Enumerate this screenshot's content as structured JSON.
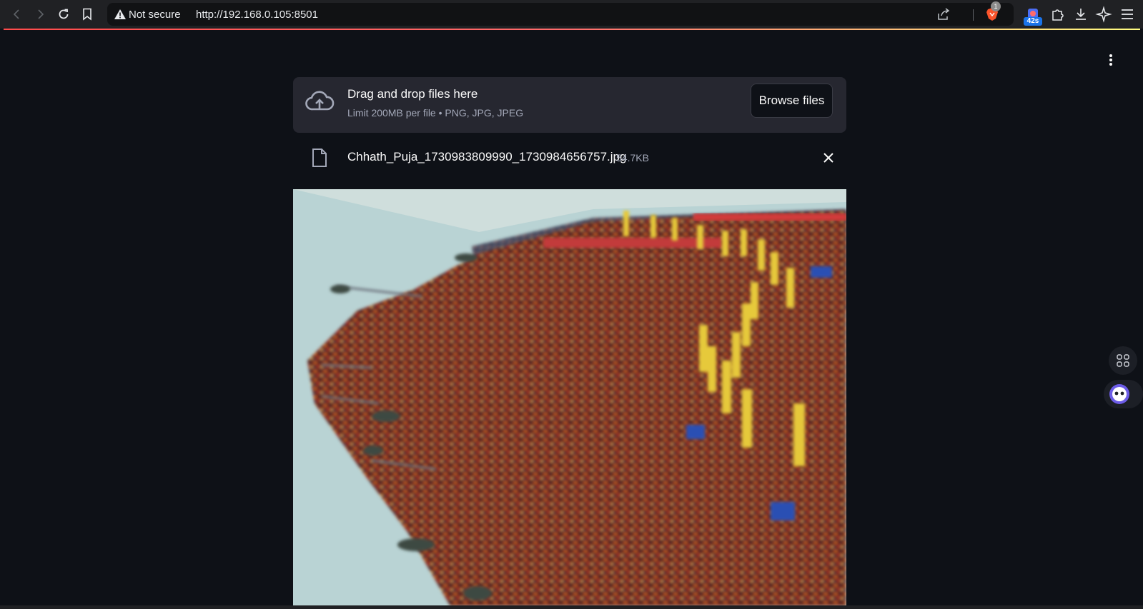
{
  "browser": {
    "security_label": "Not secure",
    "url": "http://192.168.0.105:8501",
    "brave_badge_count": "1",
    "timer_extension_label": "42s"
  },
  "icons": {
    "back": "back-arrow-icon",
    "forward": "forward-arrow-icon",
    "reload": "reload-icon",
    "bookmark": "bookmark-icon",
    "warning": "warning-icon",
    "share": "share-icon",
    "brave": "brave-lion-icon",
    "extensions": "puzzle-icon",
    "download": "download-icon",
    "leo": "sparkle-icon",
    "menu": "hamburger-menu-icon",
    "app_menu": "vertical-dots-icon",
    "upload": "cloud-upload-icon",
    "file": "file-icon",
    "remove": "close-icon"
  },
  "uploader": {
    "title": "Drag and drop files here",
    "limit_text": "Limit 200MB per file • PNG, JPG, JPEG",
    "browse_label": "Browse files"
  },
  "uploaded_file": {
    "name": "Chhath_Puja_1730983809990_1730984656757.jpg",
    "size": "54.7KB"
  },
  "colors": {
    "page_bg": "#0e1117",
    "dropzone_bg": "#262730",
    "accent_red": "#ff4b4b",
    "text_primary": "#fafafa",
    "text_muted": "#a3a8b8"
  }
}
